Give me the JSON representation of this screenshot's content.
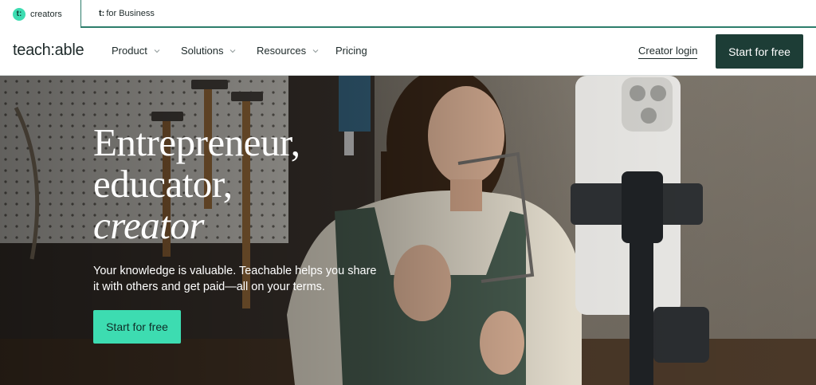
{
  "audience_tabs": {
    "creators": {
      "mark": "t:",
      "label": "creators"
    },
    "business": {
      "mark": "t:",
      "label": "for Business"
    }
  },
  "nav": {
    "brand": "teach:able",
    "items": [
      {
        "label": "Product",
        "has_dropdown": true,
        "icon": "chevron-down-icon"
      },
      {
        "label": "Solutions",
        "has_dropdown": true,
        "icon": "chevron-down-icon"
      },
      {
        "label": "Resources",
        "has_dropdown": true,
        "icon": "chevron-down-icon"
      },
      {
        "label": "Pricing",
        "has_dropdown": false
      }
    ],
    "login": "Creator login",
    "cta": "Start for free"
  },
  "hero": {
    "headline": [
      "Entrepreneur,",
      "educator,",
      "creator"
    ],
    "subcopy": "Your knowledge is valuable. Teachable helps you share it with others and get paid—all on your terms.",
    "cta": "Start for free"
  },
  "colors": {
    "accent": "#3ddcb1",
    "dark": "#1d3d36",
    "text": "#1e2a2a",
    "business_tab_border": "#2d7d6b"
  }
}
